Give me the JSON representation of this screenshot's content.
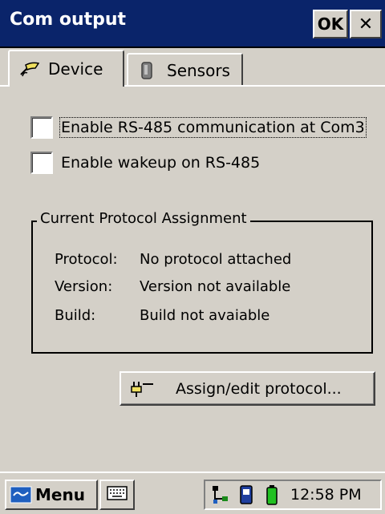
{
  "window": {
    "title": "Com output",
    "ok_label": "OK",
    "close_label": "✕"
  },
  "tabs": [
    {
      "label": "Device",
      "icon": "device-icon",
      "active": true
    },
    {
      "label": "Sensors",
      "icon": "sensor-icon",
      "active": false
    }
  ],
  "options": {
    "rs485_label": "Enable RS-485 communication at Com3",
    "rs485_checked": false,
    "wakeup_label": "Enable wakeup on RS-485",
    "wakeup_checked": false
  },
  "protocol_group": {
    "legend": "Current Protocol Assignment",
    "protocol_key": "Protocol:",
    "protocol_value": "No protocol attached",
    "version_key": "Version:",
    "version_value": "Version not available",
    "build_key": "Build:",
    "build_value": "Build not avaiable"
  },
  "assign_button": {
    "label": "Assign/edit protocol...",
    "icon": "plug-icon"
  },
  "taskbar": {
    "menu_label": "Menu",
    "clock": "12:58 PM",
    "tray_icons": [
      "network-icon",
      "device-status-icon",
      "battery-icon"
    ]
  },
  "colors": {
    "titlebar": "#0a246a",
    "face": "#d4d0c8"
  }
}
